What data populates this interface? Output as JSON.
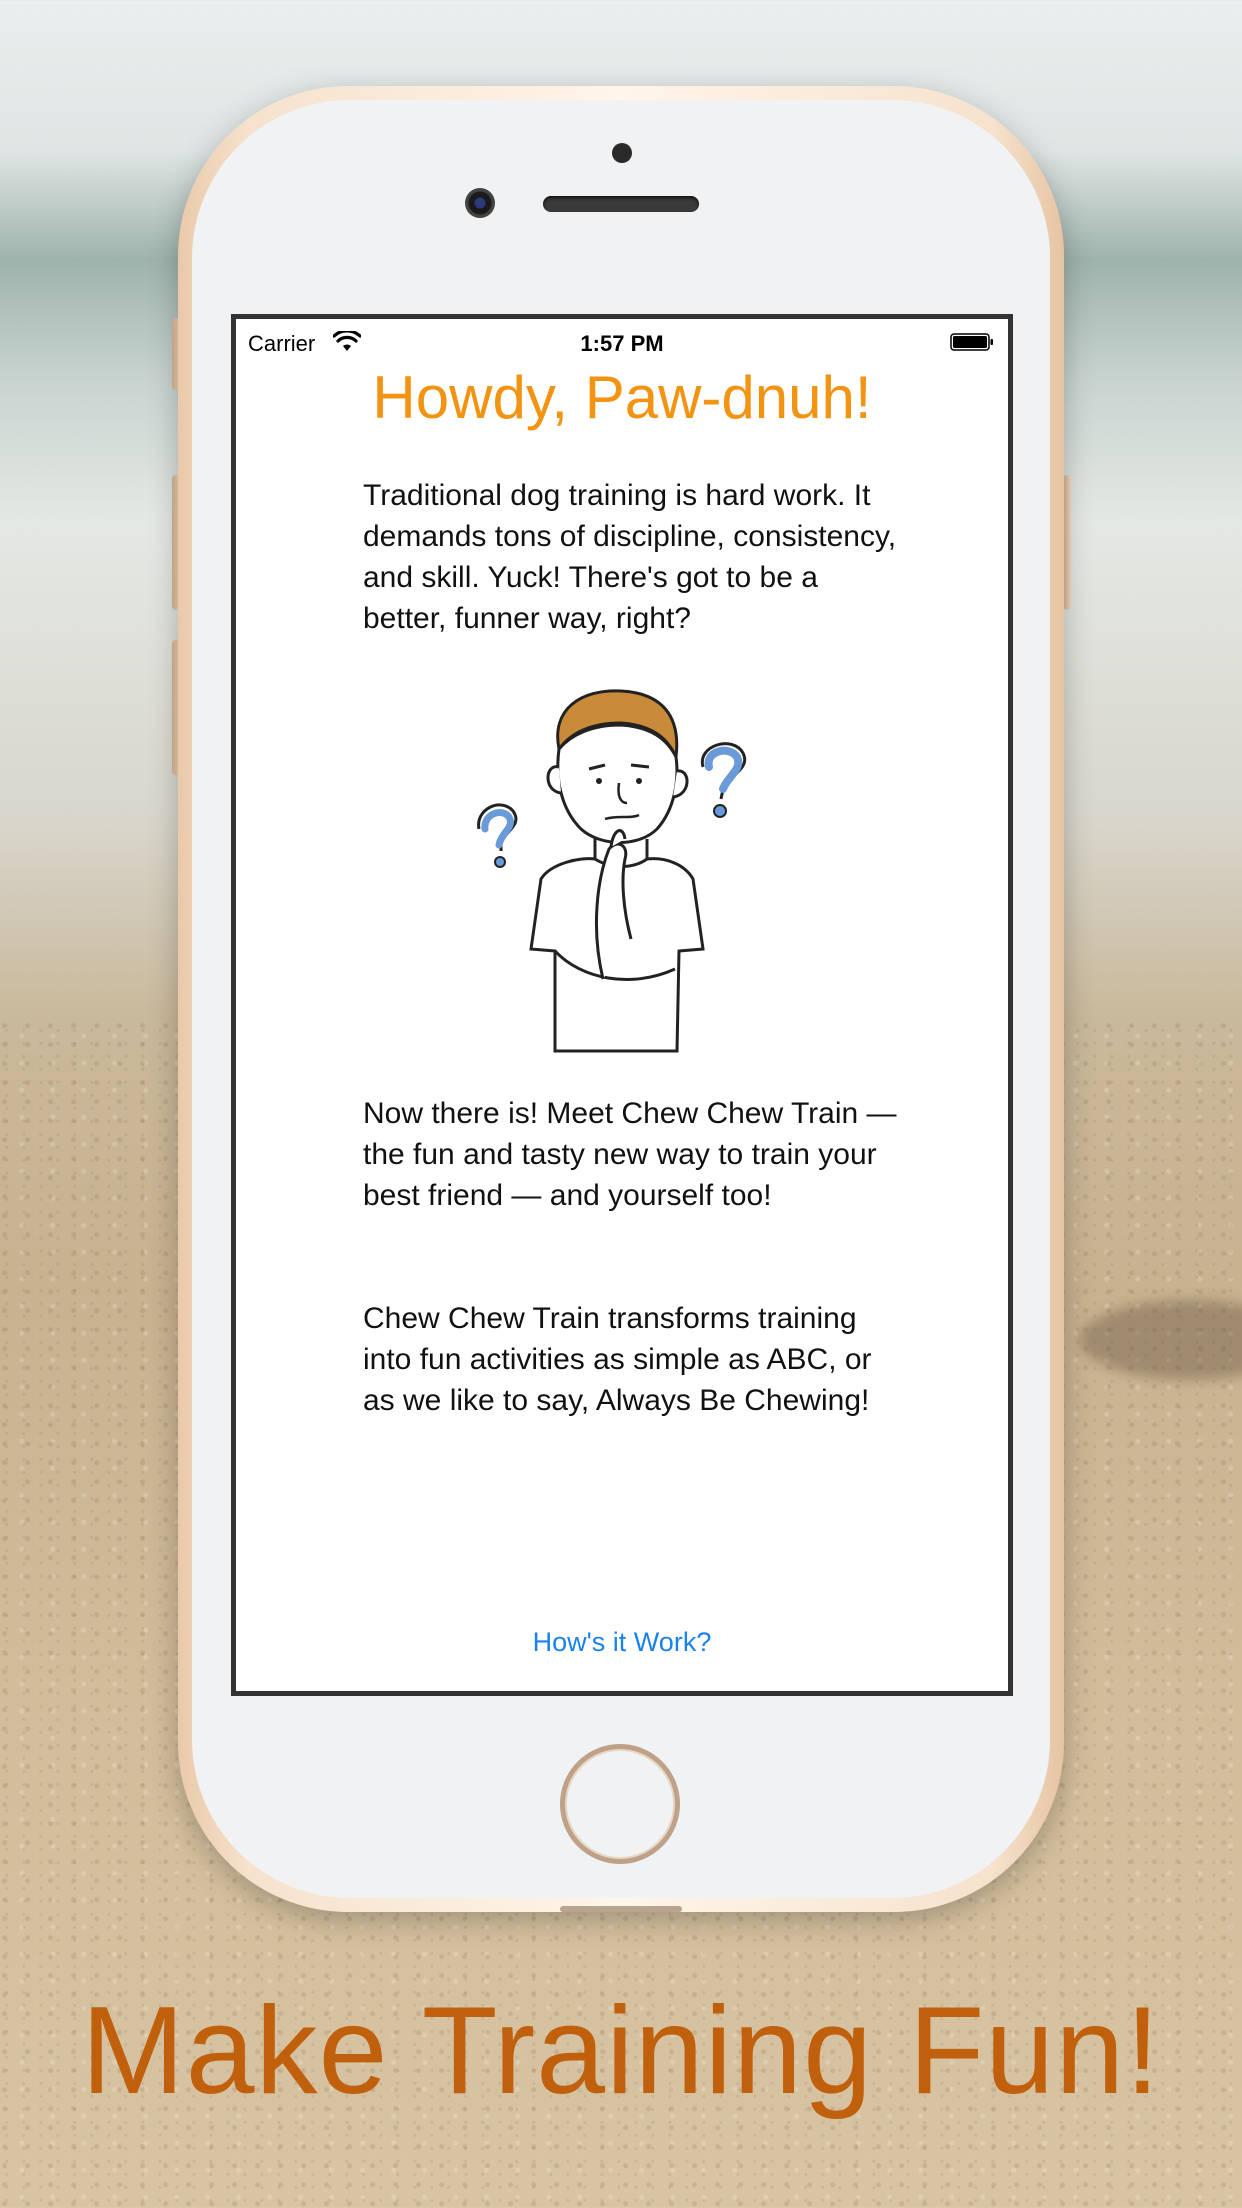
{
  "status_bar": {
    "carrier": "Carrier",
    "time": "1:57 PM"
  },
  "screen": {
    "title": "Howdy, Paw-dnuh!",
    "paragraph_1": "Traditional dog training is hard work. It demands tons of discipline, consistency, and skill. Yuck! There's got to be a better, funner way, right?",
    "paragraph_2": "Now there is! Meet Chew Chew Train — the fun and tasty new way to train your best friend — and yourself too!",
    "paragraph_3": "Chew Chew Train transforms training into fun activities as simple as ABC, or as we like to say, Always Be Chewing!",
    "link_label": "How's it Work?"
  },
  "tagline": "Make Training Fun!",
  "colors": {
    "title": "#f39312",
    "link": "#1a82f0",
    "tagline": "#c05f0c",
    "question_marks": "#6a9ad8"
  },
  "icons": [
    "wifi-icon",
    "battery-icon",
    "thinking-person-illustration"
  ]
}
